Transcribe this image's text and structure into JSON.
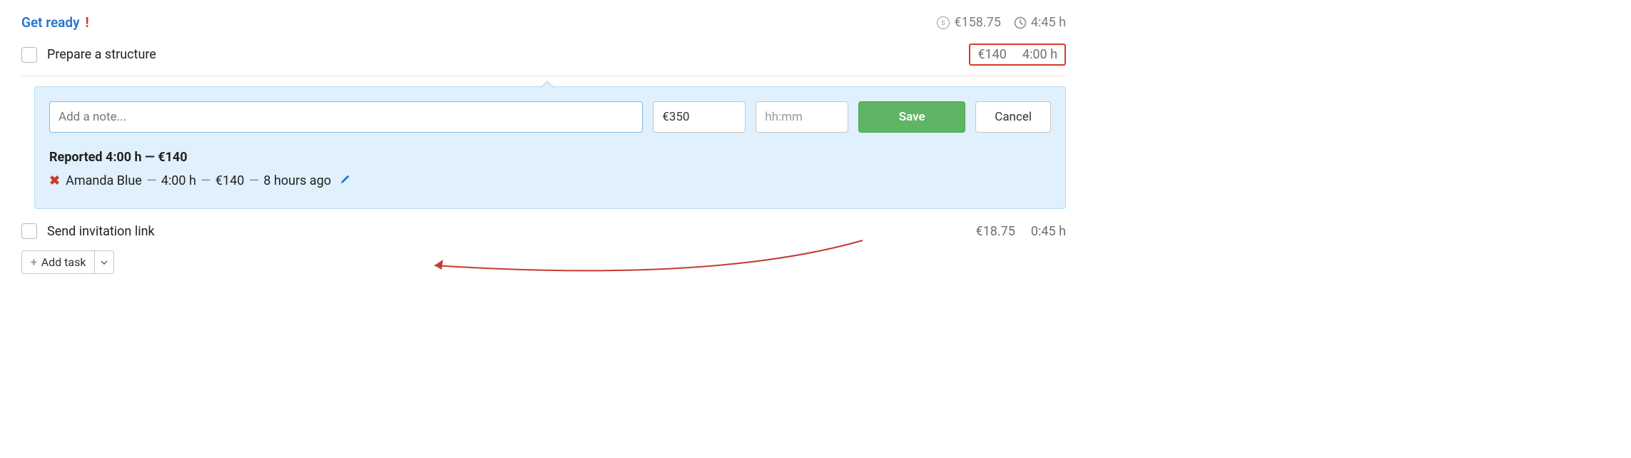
{
  "section": {
    "title": "Get ready",
    "total_cost": "€158.75",
    "total_time": "4:45 h"
  },
  "tasks": [
    {
      "name": "Prepare a structure",
      "cost": "€140",
      "time": "4:00 h"
    },
    {
      "name": "Send invitation link",
      "cost": "€18.75",
      "time": "0:45 h"
    }
  ],
  "panel": {
    "note_placeholder": "Add a note...",
    "amount_value": "€350",
    "time_placeholder": "hh:mm",
    "save_label": "Save",
    "cancel_label": "Cancel",
    "reported_summary": "Reported 4:00 h — €140",
    "entry": {
      "user": "Amanda Blue",
      "hours": "4:00 h",
      "amount": "€140",
      "ago": "8 hours ago"
    }
  },
  "footer": {
    "add_task_label": "Add task"
  }
}
